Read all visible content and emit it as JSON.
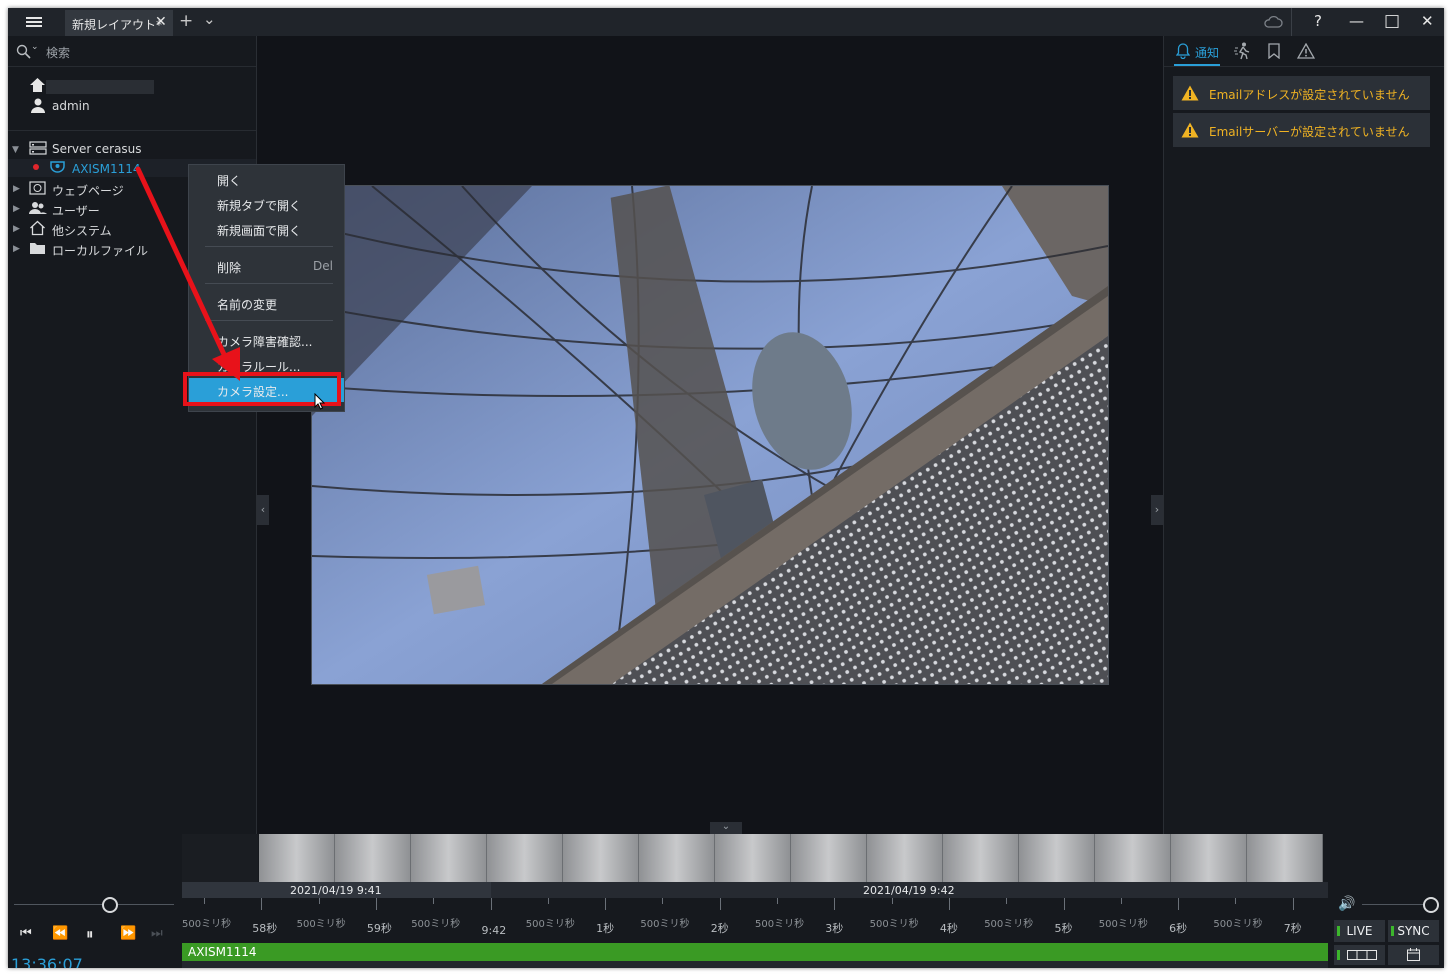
{
  "titlebar": {
    "tab_label": "新規レイアウト*",
    "tab_close": "✕",
    "add_tab": "+",
    "tab_menu": "⌄",
    "help": "?",
    "minimize": "—",
    "maximize": "□",
    "close": "✕"
  },
  "left": {
    "search_placeholder": "検索",
    "user": "admin",
    "server": "Server cerasus",
    "camera": "AXISM1114",
    "items": [
      "ウェブページ",
      "ユーザー",
      "他システム",
      "ローカルファイル"
    ]
  },
  "context_menu": {
    "open": "開く",
    "open_new_tab": "新規タブで開く",
    "open_new_screen": "新規画面で開く",
    "delete": "削除",
    "delete_shortcut": "Del",
    "rename": "名前の変更",
    "camera_issue": "カメラ障害確認...",
    "camera_rule": "カメラルール...",
    "camera_settings": "カメラ設定..."
  },
  "right": {
    "tab_notify": "通知",
    "notifications": [
      "Emailアドレスが設定されていません",
      "Emailサーバーが設定されていません"
    ]
  },
  "timeline": {
    "date1": "2021/04/19 9:41",
    "date2": "2021/04/19 9:42",
    "ticks": [
      "500ミリ秒",
      "58秒",
      "500ミリ秒",
      "59秒",
      "500ミリ秒",
      "9:42",
      "500ミリ秒",
      "1秒",
      "500ミリ秒",
      "2秒",
      "500ミリ秒",
      "3秒",
      "500ミリ秒",
      "4秒",
      "500ミリ秒",
      "5秒",
      "500ミリ秒",
      "6秒",
      "500ミリ秒",
      "7秒"
    ],
    "track_label": "AXISM1114",
    "clock": "13:36:07",
    "live": "LIVE",
    "sync": "SYNC"
  },
  "colors": {
    "accent": "#2a9fd8",
    "warning": "#f0b323",
    "track": "#3a9a24",
    "highlight": "#e8121a"
  }
}
